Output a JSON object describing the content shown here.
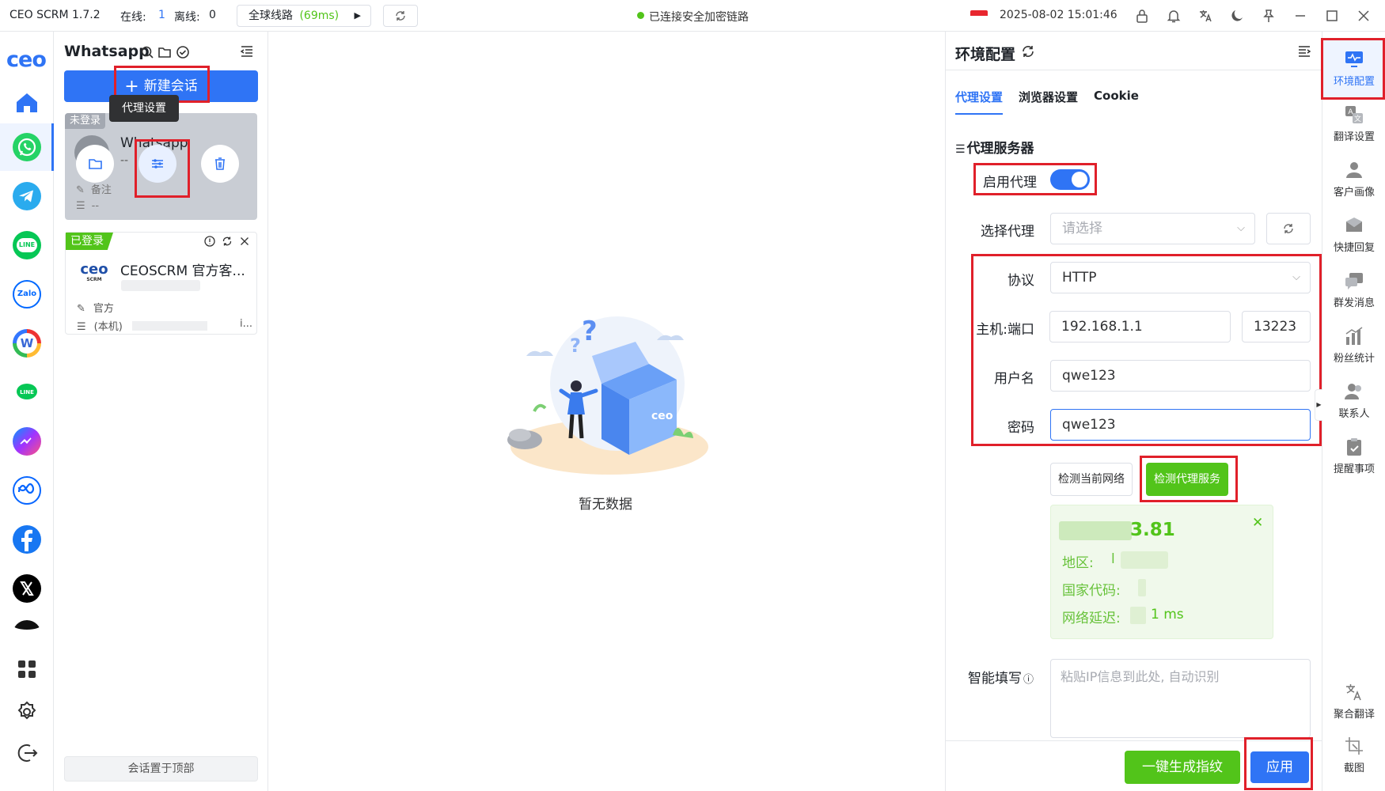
{
  "app": {
    "title": "CEO SCRM 1.7.2",
    "online_label": "在线:",
    "online_count": "1",
    "offline_label": "离线:",
    "offline_count": "0",
    "route_label": "全球线路",
    "route_latency": "(69ms)",
    "connection_status": "已连接安全加密链路",
    "datetime": "2025-08-02 15:01:46"
  },
  "sidebar": {
    "logo": "ceo",
    "platforms": [
      "home-icon",
      "whatsapp-icon",
      "telegram-icon",
      "line-icon",
      "zalo-icon",
      "wechat-icon",
      "line-green-icon",
      "messenger-icon",
      "meta-icon",
      "facebook-icon",
      "x-icon",
      "tiktok-icon"
    ],
    "zalo_text": "Zalo",
    "line_text": "LINE"
  },
  "sessions": {
    "title": "Whatsapp",
    "new_session_label": "新建会话",
    "tooltip": "代理设置",
    "pin_top_label": "会话置于顶部",
    "cards": [
      {
        "status": "未登录",
        "name": "Whatsapp",
        "sub": "--",
        "note": "备注",
        "proxy": "--"
      },
      {
        "status": "已登录",
        "name": "CEOSCRM 官方客...",
        "note": "官方",
        "proxy": "(本机)",
        "proxy_tail": "i..."
      }
    ]
  },
  "main": {
    "empty_text": "暂无数据"
  },
  "config": {
    "title": "环境配置",
    "tabs": [
      "代理设置",
      "浏览器设置",
      "Cookie"
    ],
    "active_tab": 0,
    "section_title": "代理服务器",
    "enable_proxy_label": "启用代理",
    "enable_proxy_on": true,
    "select_proxy_label": "选择代理",
    "select_proxy_placeholder": "请选择",
    "protocol_label": "协议",
    "protocol_value": "HTTP",
    "host_label": "主机:端口",
    "host_value": "192.168.1.1",
    "port_value": "13223",
    "username_label": "用户名",
    "username_value": "qwe123",
    "password_label": "密码",
    "password_value": "qwe123",
    "check_network_label": "检测当前网络",
    "check_proxy_label": "检测代理服务",
    "result": {
      "ip_tail": "3.81",
      "region_label": "地区:",
      "region_tail": "l",
      "country_label": "国家代码:",
      "latency_label": "网络延迟:",
      "latency_value": "1 ms"
    },
    "smart_fill_label": "智能填写",
    "smart_fill_placeholder": "粘贴IP信息到此处, 自动识别",
    "generate_fp_label": "一键生成指纹",
    "apply_label": "应用"
  },
  "rail": {
    "tools": [
      "环境配置",
      "翻译设置",
      "客户画像",
      "快捷回复",
      "群发消息",
      "粉丝统计",
      "联系人",
      "提醒事项"
    ],
    "bottom_tools": [
      "聚合翻译",
      "截图"
    ]
  },
  "colors": {
    "primary": "#2f74f5",
    "success": "#52c41a",
    "annotation": "#e0202a",
    "whatsapp": "#25d366"
  }
}
